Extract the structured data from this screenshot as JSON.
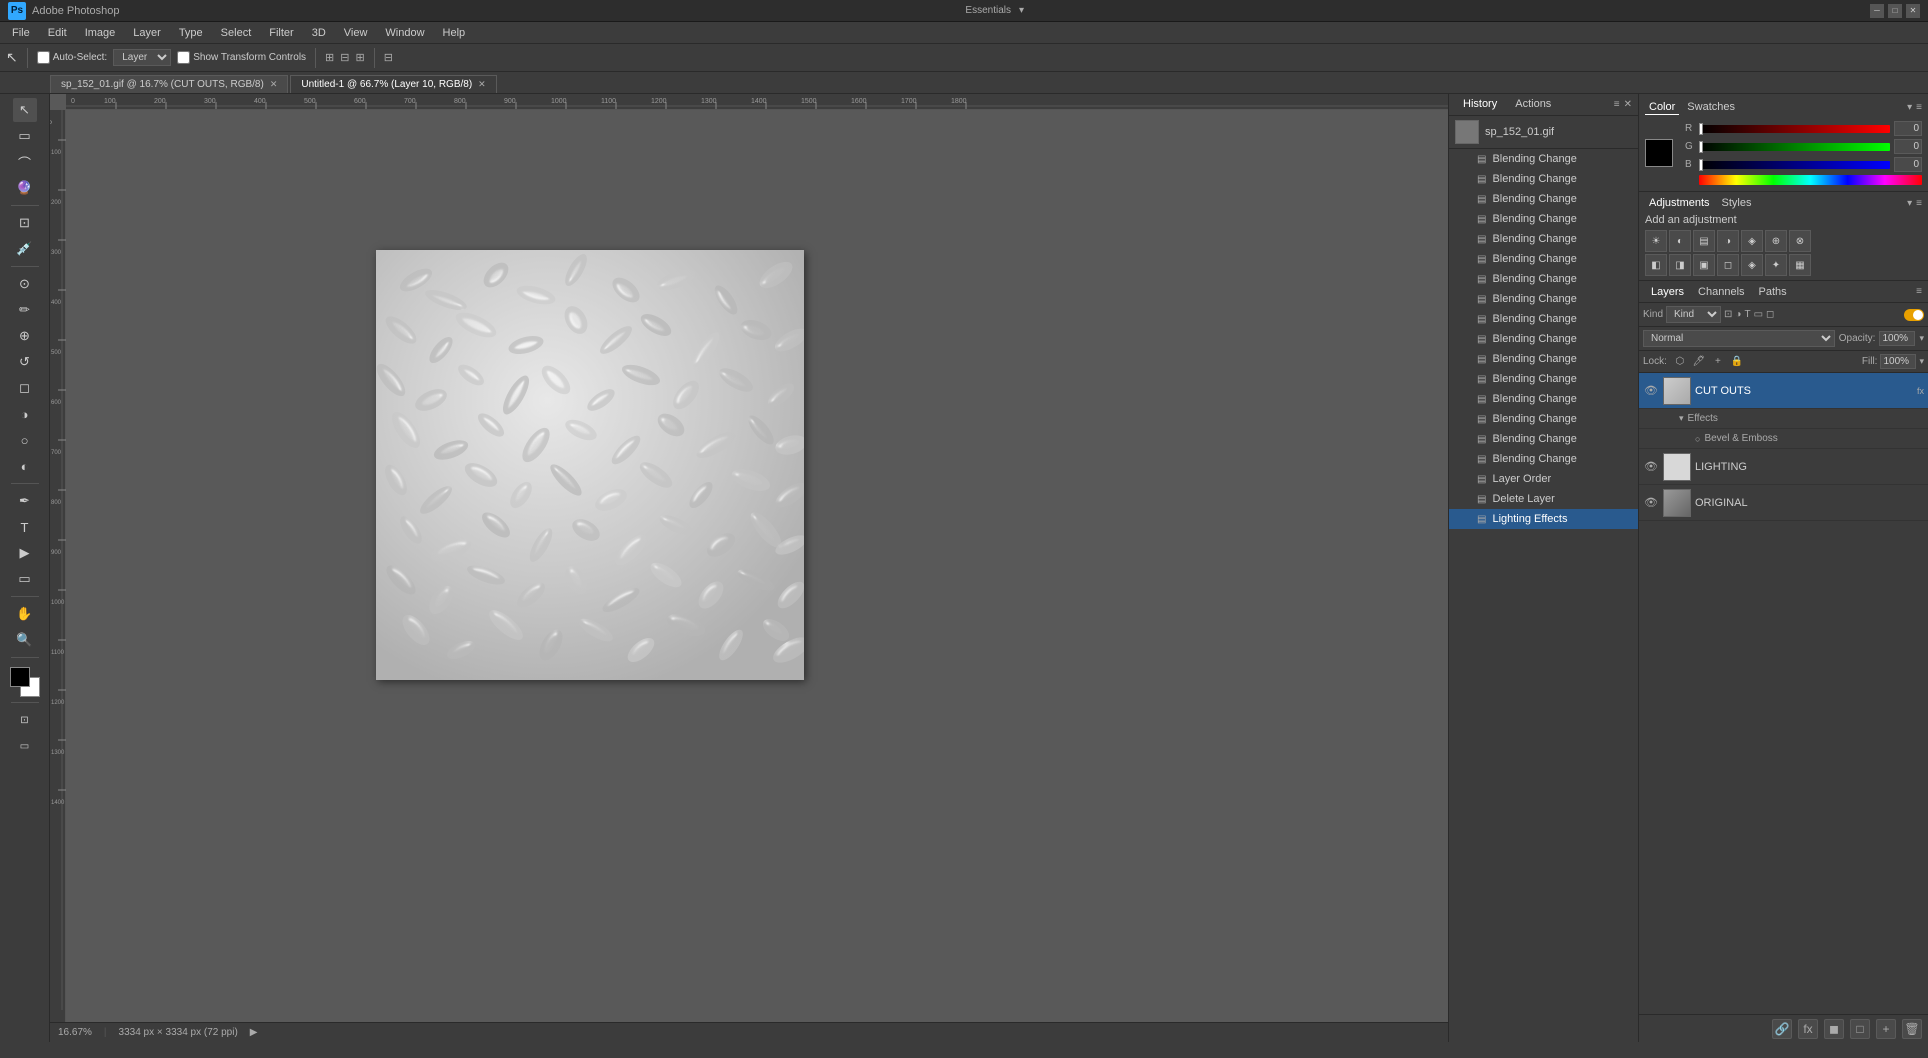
{
  "titlebar": {
    "title": "Adobe Photoshop",
    "logo": "Ps",
    "workspace": "Essentials"
  },
  "menubar": {
    "items": [
      "File",
      "Edit",
      "Image",
      "Layer",
      "Type",
      "Select",
      "Filter",
      "3D",
      "View",
      "Window",
      "Help"
    ]
  },
  "optionsbar": {
    "auto_select_label": "Auto-Select:",
    "layer_select": "Layer",
    "show_transform_label": "Show Transform Controls",
    "tool_icon": "↖"
  },
  "doctabs": {
    "tabs": [
      {
        "name": "sp_152_01.gif @ 16.7% (CUT OUTS, RGB/8)",
        "active": false,
        "modified": true
      },
      {
        "name": "Untitled-1 @ 66.7% (Layer 10, RGB/8)",
        "active": true,
        "modified": true
      }
    ]
  },
  "history_panel": {
    "tabs": [
      "History",
      "Actions"
    ],
    "snapshot": {
      "name": "sp_152_01.gif",
      "icon": "📷"
    },
    "items": [
      "Blending Change",
      "Blending Change",
      "Blending Change",
      "Blending Change",
      "Blending Change",
      "Blending Change",
      "Blending Change",
      "Blending Change",
      "Blending Change",
      "Blending Change",
      "Blending Change",
      "Blending Change",
      "Blending Change",
      "Blending Change",
      "Blending Change",
      "Blending Change",
      "Layer Order",
      "Delete Layer",
      "Lighting Effects"
    ],
    "active_index": 18
  },
  "color_panel": {
    "tabs": [
      "Color",
      "Swatches"
    ],
    "active_tab": "Color",
    "channels": [
      {
        "label": "R",
        "value": 0,
        "max": 255
      },
      {
        "label": "G",
        "value": 0,
        "max": 255
      },
      {
        "label": "B",
        "value": 0,
        "max": 255
      }
    ]
  },
  "adjustments_panel": {
    "tabs": [
      "Adjustments",
      "Styles"
    ],
    "active_tab": "Adjustments",
    "title": "Add an adjustment",
    "icons_row1": [
      "☀",
      "◐",
      "▤",
      "◑",
      "◈",
      "⊕",
      "⊗"
    ],
    "icons_row2": [
      "◧",
      "◨",
      "▣",
      "◻",
      "◈",
      "✦",
      "▦"
    ]
  },
  "layers_panel": {
    "tabs": [
      "Layers",
      "Channels",
      "Paths"
    ],
    "active_tab": "Layers",
    "filter_type": "Kind",
    "blend_mode": "Normal",
    "opacity": "100%",
    "fill": "100%",
    "lock_options": [
      "🔒",
      "✦",
      "🖊",
      "+",
      "🔒"
    ],
    "layers": [
      {
        "name": "CUT OUTS",
        "visible": true,
        "active": true,
        "thumb_color": "#ccc",
        "has_effects": true,
        "effects": [
          "Effects"
        ],
        "sub_effects": [
          "Bevel & Emboss"
        ]
      },
      {
        "name": "LIGHTING",
        "visible": true,
        "active": false,
        "thumb_color": "#d0d0d0",
        "has_effects": false
      },
      {
        "name": "ORIGINAL",
        "visible": true,
        "active": false,
        "thumb_color": "#888",
        "has_effects": false
      }
    ],
    "footer_buttons": [
      "🔗",
      "fx",
      "◼",
      "◻",
      "🗑"
    ]
  },
  "statusbar": {
    "zoom": "16.67%",
    "dimensions": "3334 px × 3334 px (72 ppi)"
  },
  "canvas": {
    "image_alt": "Embossed floral texture"
  }
}
